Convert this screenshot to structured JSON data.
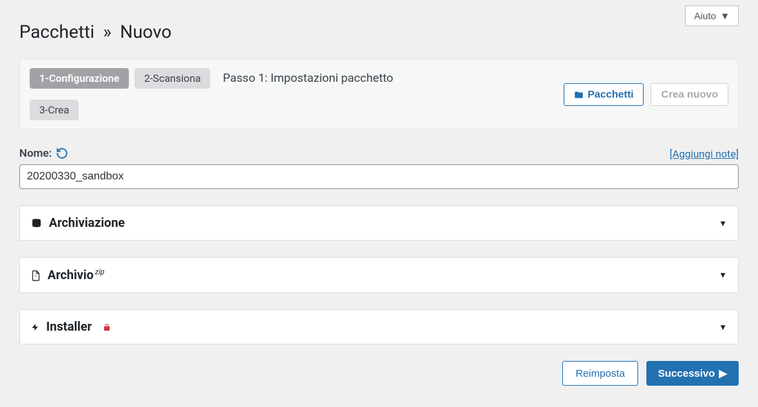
{
  "header": {
    "title_main": "Pacchetti",
    "title_sep": "»",
    "title_sub": "Nuovo",
    "help_label": "Aiuto"
  },
  "steps": {
    "step1": "1-Configurazione",
    "step2": "2-Scansiona",
    "step3": "3-Crea",
    "heading": "Passo 1: Impostazioni pacchetto",
    "packages_btn": "Pacchetti",
    "create_btn": "Crea nuovo"
  },
  "form": {
    "name_label": "Nome:",
    "add_notes": "[Aggiungi note]",
    "name_value": "20200330_sandbox"
  },
  "panels": {
    "storage": "Archiviazione",
    "archive": "Archivio",
    "archive_sup": "zip",
    "installer": "Installer"
  },
  "footer": {
    "reset": "Reimposta",
    "next": "Successivo"
  }
}
